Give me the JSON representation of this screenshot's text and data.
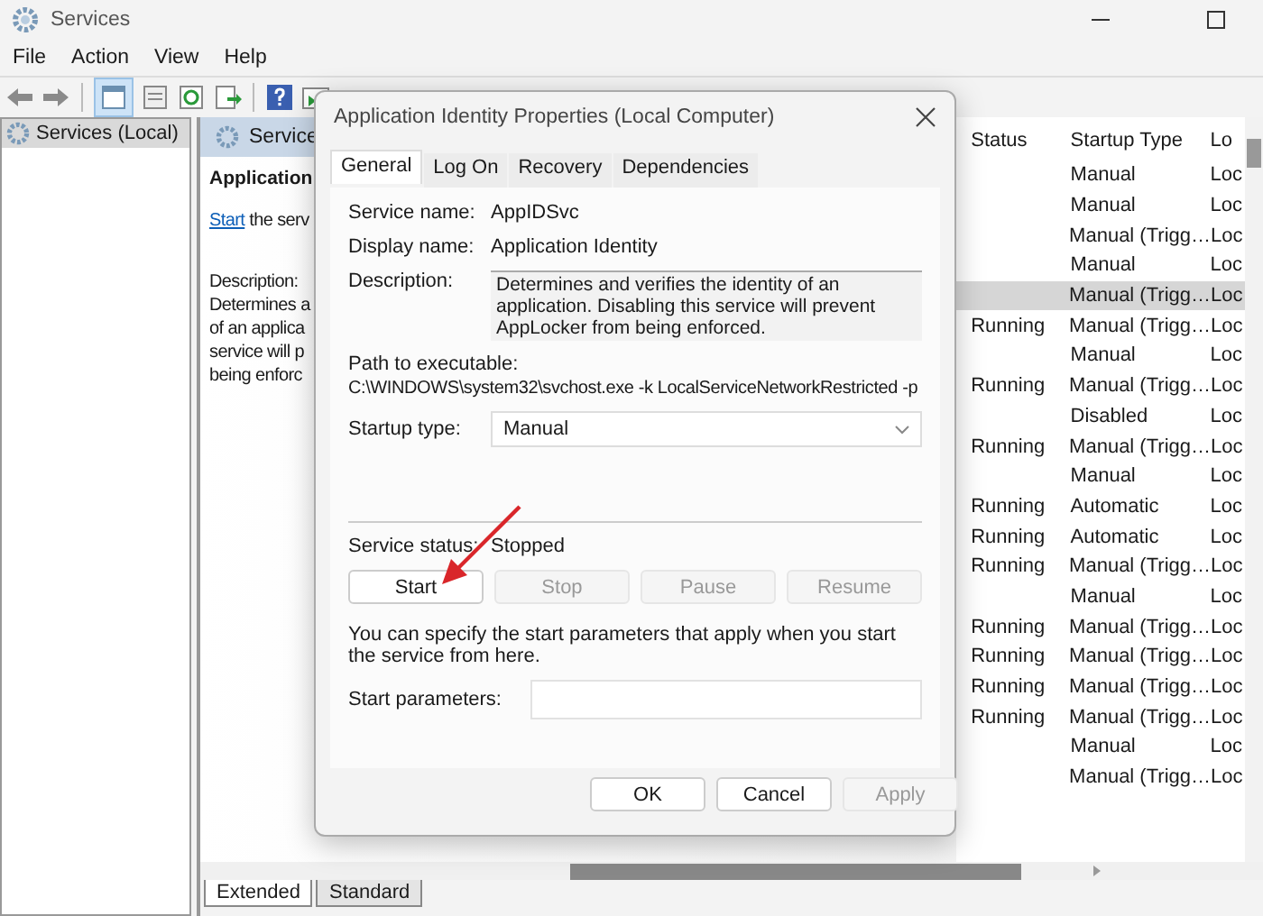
{
  "window": {
    "title": "Services"
  },
  "menu": [
    "File",
    "Action",
    "View",
    "Help"
  ],
  "tree": {
    "items": [
      {
        "label": "Services (Local)",
        "selected": true
      }
    ]
  },
  "detail": {
    "header": "Service",
    "name": "Application",
    "link": "Start",
    "link_rest": "the serv",
    "description_label": "Description:",
    "description_lines": [
      "Determines a",
      "of an applica",
      "service will p",
      "being enforc"
    ]
  },
  "table": {
    "columns": [
      "Status",
      "Startup Type",
      "Lo"
    ],
    "rows": [
      {
        "status": "",
        "startup": "Manual",
        "logon": "Loc",
        "selected": false
      },
      {
        "status": "",
        "startup": "Manual",
        "logon": "Loc",
        "selected": false
      },
      {
        "status": "",
        "startup": "Manual (Trigg…",
        "logon": "Loc",
        "selected": false
      },
      {
        "status": "",
        "startup": "Manual",
        "logon": "Loc",
        "selected": false
      },
      {
        "status": "",
        "startup": "Manual (Trigg…",
        "logon": "Loc",
        "selected": true
      },
      {
        "status": "Running",
        "startup": "Manual (Trigg…",
        "logon": "Loc",
        "selected": false
      },
      {
        "status": "",
        "startup": "Manual",
        "logon": "Loc",
        "selected": false
      },
      {
        "status": "Running",
        "startup": "Manual (Trigg…",
        "logon": "Loc",
        "selected": false
      },
      {
        "status": "",
        "startup": "Disabled",
        "logon": "Loc",
        "selected": false
      },
      {
        "status": "Running",
        "startup": "Manual (Trigg…",
        "logon": "Loc",
        "selected": false
      },
      {
        "status": "",
        "startup": "Manual",
        "logon": "Loc",
        "selected": false
      },
      {
        "status": "Running",
        "startup": "Automatic",
        "logon": "Loc",
        "selected": false
      },
      {
        "status": "Running",
        "startup": "Automatic",
        "logon": "Loc",
        "selected": false
      },
      {
        "status": "Running",
        "startup": "Manual (Trigg…",
        "logon": "Loc",
        "selected": false
      },
      {
        "status": "",
        "startup": "Manual",
        "logon": "Loc",
        "selected": false
      },
      {
        "status": "Running",
        "startup": "Manual (Trigg…",
        "logon": "Loc",
        "selected": false
      },
      {
        "status": "Running",
        "startup": "Manual (Trigg…",
        "logon": "Loc",
        "selected": false
      },
      {
        "status": "Running",
        "startup": "Manual (Trigg…",
        "logon": "Loc",
        "selected": false
      },
      {
        "status": "Running",
        "startup": "Manual (Trigg…",
        "logon": "Loc",
        "selected": false
      },
      {
        "status": "",
        "startup": "Manual",
        "logon": "Loc",
        "selected": false
      },
      {
        "status": "",
        "startup": "Manual (Trigg…",
        "logon": "Loc",
        "selected": false
      }
    ]
  },
  "view_tabs": [
    {
      "label": "Extended",
      "selected": true
    },
    {
      "label": "Standard",
      "selected": false
    }
  ],
  "dialog": {
    "title": "Application Identity Properties (Local Computer)",
    "tabs": [
      {
        "label": "General",
        "selected": true
      },
      {
        "label": "Log On",
        "selected": false
      },
      {
        "label": "Recovery",
        "selected": false
      },
      {
        "label": "Dependencies",
        "selected": false
      }
    ],
    "service_name_label": "Service name:",
    "service_name": "AppIDSvc",
    "display_name_label": "Display name:",
    "display_name": "Application Identity",
    "description_label": "Description:",
    "description": "Determines and verifies the identity of an application. Disabling this service will prevent AppLocker from being enforced.",
    "path_label": "Path to executable:",
    "path": "C:\\WINDOWS\\system32\\svchost.exe -k LocalServiceNetworkRestricted -p",
    "startup_label": "Startup type:",
    "startup_value": "Manual",
    "status_label": "Service status:",
    "status_value": "Stopped",
    "control_buttons": [
      {
        "label": "Start",
        "disabled": false
      },
      {
        "label": "Stop",
        "disabled": true
      },
      {
        "label": "Pause",
        "disabled": true
      },
      {
        "label": "Resume",
        "disabled": true
      }
    ],
    "hint": "You can specify the start parameters that apply when you start the service from here.",
    "params_label": "Start parameters:",
    "buttons": [
      {
        "label": "OK",
        "disabled": false
      },
      {
        "label": "Cancel",
        "disabled": false
      },
      {
        "label": "Apply",
        "disabled": true
      }
    ]
  }
}
